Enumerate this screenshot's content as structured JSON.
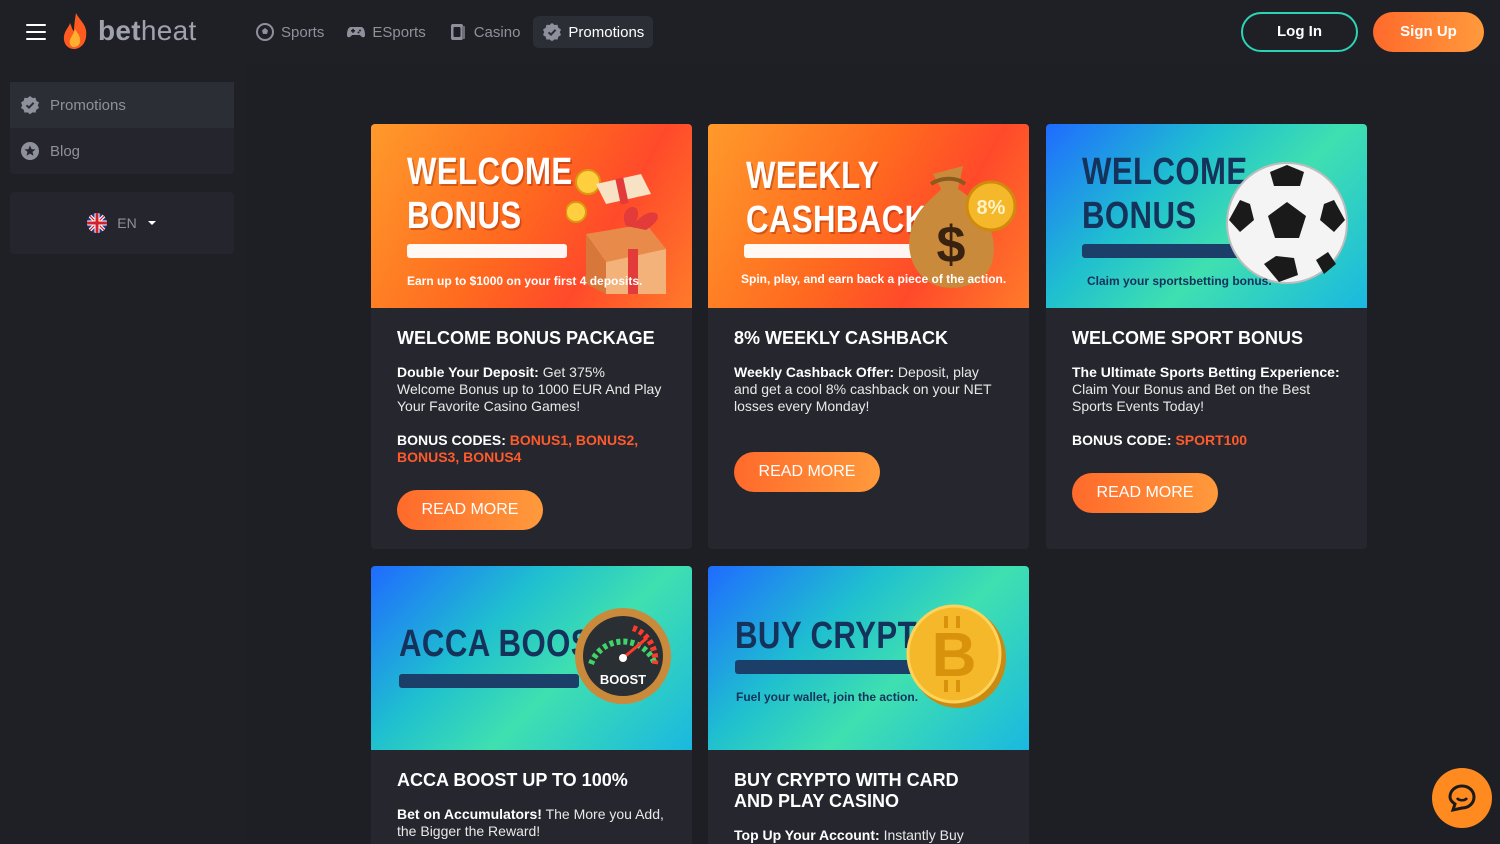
{
  "header": {
    "logo_bold": "bet",
    "logo_thin": "heat",
    "nav": [
      {
        "label": "Sports",
        "icon": "soccer-ball-icon"
      },
      {
        "label": "ESports",
        "icon": "gamepad-icon"
      },
      {
        "label": "Casino",
        "icon": "cards-icon"
      },
      {
        "label": "Promotions",
        "icon": "badge-check-icon"
      }
    ],
    "login_label": "Log In",
    "signup_label": "Sign Up"
  },
  "sidebar": {
    "items": [
      {
        "label": "Promotions",
        "icon": "badge-check-icon"
      },
      {
        "label": "Blog",
        "icon": "star-badge-icon"
      }
    ],
    "language": "EN"
  },
  "promos": [
    {
      "banner_title_1": "WELCOME",
      "banner_title_2": "BONUS",
      "banner_sub": "Earn up to $1000 on your first 4 deposits.",
      "title": "WELCOME BONUS PACKAGE",
      "desc_bold": "Double Your Deposit:",
      "desc": " Get 375% Welcome Bonus up to 1000 EUR And Play Your Favorite Casino Games!",
      "codes_label": "BONUS CODES: ",
      "codes": "BONUS1, BONUS2, BONUS3, BONUS4",
      "button": "READ MORE"
    },
    {
      "banner_title_1": "WEEKLY",
      "banner_title_2": "CASHBACK",
      "banner_sub": "Spin, play, and earn back a piece of the action.",
      "banner_badge": "8%",
      "title": "8% WEEKLY CASHBACK",
      "desc_bold": "Weekly Cashback Offer:",
      "desc": " Deposit, play and get a cool 8% cashback on your NET losses every Monday!",
      "button": "READ MORE"
    },
    {
      "banner_title_1": "WELCOME",
      "banner_title_2": "BONUS",
      "banner_sub": "Claim your sportsbetting bonus.",
      "title": "WELCOME SPORT BONUS",
      "desc_bold": "The Ultimate Sports Betting Experience:",
      "desc": " Claim Your Bonus and Bet on the Best Sports Events Today!",
      "codes_label": "BONUS CODE: ",
      "codes": "SPORT100",
      "button": "READ MORE"
    },
    {
      "banner_title_1": "ACCA BOOST",
      "banner_badge": "BOOST",
      "title": "ACCA BOOST UP TO 100%",
      "desc_bold": "Bet on Accumulators!",
      "desc": " The More you Add, the Bigger the Reward!"
    },
    {
      "banner_title_1": "BUY CRYPTO",
      "banner_sub": "Fuel your wallet, join the action.",
      "title_1": "BUY CRYPTO WITH CARD",
      "title_2": "AND PLAY CASINO",
      "desc_bold": "Top Up Your Account:",
      "desc": " Instantly Buy"
    }
  ]
}
